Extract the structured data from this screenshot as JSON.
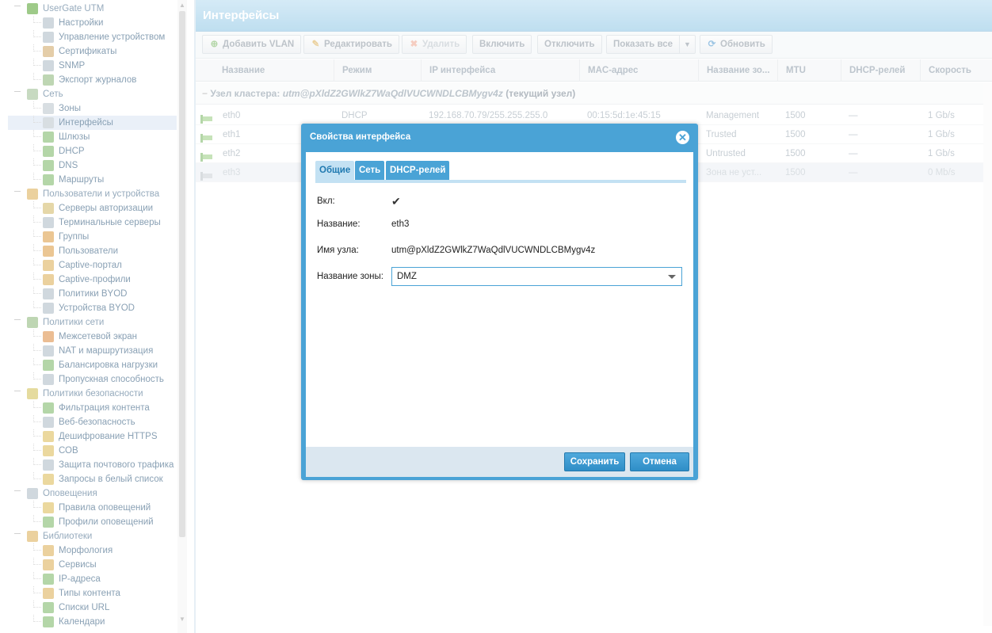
{
  "sidebar": {
    "items": [
      {
        "label": "UserGate UTM",
        "level": 0,
        "icon": "usergate-icon",
        "color": "#6aae4a"
      },
      {
        "label": "Настройки",
        "level": 1,
        "icon": "settings-icon",
        "color": "#b7c3cc"
      },
      {
        "label": "Управление устройством",
        "level": 1,
        "icon": "device-icon",
        "color": "#b7c3cc"
      },
      {
        "label": "Сертификаты",
        "level": 1,
        "icon": "certificate-icon",
        "color": "#d6b37a"
      },
      {
        "label": "SNMP",
        "level": 1,
        "icon": "snmp-icon",
        "color": "#b7c3cc"
      },
      {
        "label": "Экспорт журналов",
        "level": 1,
        "icon": "log-export-icon",
        "color": "#9bc08a"
      },
      {
        "label": "Сеть",
        "level": 0,
        "icon": "network-icon",
        "color": "#a9c7a0"
      },
      {
        "label": "Зоны",
        "level": 1,
        "icon": "zones-icon",
        "color": "#c4ccd3"
      },
      {
        "label": "Интерфейсы",
        "level": 1,
        "icon": "interfaces-icon",
        "color": "#c4ccd3",
        "selected": true
      },
      {
        "label": "Шлюзы",
        "level": 1,
        "icon": "gateways-icon",
        "color": "#8cc07a"
      },
      {
        "label": "DHCP",
        "level": 1,
        "icon": "dhcp-icon",
        "color": "#8cc07a"
      },
      {
        "label": "DNS",
        "level": 1,
        "icon": "dns-icon",
        "color": "#8cc07a"
      },
      {
        "label": "Маршруты",
        "level": 1,
        "icon": "routes-icon",
        "color": "#8cc07a"
      },
      {
        "label": "Пользователи и устройства",
        "level": 0,
        "icon": "users-devices-icon",
        "color": "#e0b86b"
      },
      {
        "label": "Серверы авторизации",
        "level": 1,
        "icon": "auth-servers-icon",
        "color": "#d8c27a"
      },
      {
        "label": "Терминальные серверы",
        "level": 1,
        "icon": "terminal-servers-icon",
        "color": "#b7c3cc"
      },
      {
        "label": "Группы",
        "level": 1,
        "icon": "groups-icon",
        "color": "#e0a85a"
      },
      {
        "label": "Пользователи",
        "level": 1,
        "icon": "users-icon",
        "color": "#e0a85a"
      },
      {
        "label": "Captive-портал",
        "level": 1,
        "icon": "captive-portal-icon",
        "color": "#e0b86b"
      },
      {
        "label": "Captive-профили",
        "level": 1,
        "icon": "captive-profiles-icon",
        "color": "#e0b86b"
      },
      {
        "label": "Политики BYOD",
        "level": 1,
        "icon": "byod-policies-icon",
        "color": "#b7c3cc"
      },
      {
        "label": "Устройства BYOD",
        "level": 1,
        "icon": "byod-devices-icon",
        "color": "#b7c3cc"
      },
      {
        "label": "Политики сети",
        "level": 0,
        "icon": "network-policies-icon",
        "color": "#9bc08a"
      },
      {
        "label": "Межсетевой экран",
        "level": 1,
        "icon": "firewall-icon",
        "color": "#e09a5a"
      },
      {
        "label": "NAT и маршрутизация",
        "level": 1,
        "icon": "nat-icon",
        "color": "#b7c3cc"
      },
      {
        "label": "Балансировка нагрузки",
        "level": 1,
        "icon": "load-balancing-icon",
        "color": "#8cc07a"
      },
      {
        "label": "Пропускная способность",
        "level": 1,
        "icon": "bandwidth-icon",
        "color": "#b7c3cc"
      },
      {
        "label": "Политики безопасности",
        "level": 0,
        "icon": "security-policies-icon",
        "color": "#d8c86a"
      },
      {
        "label": "Фильтрация контента",
        "level": 1,
        "icon": "content-filter-icon",
        "color": "#8cc07a"
      },
      {
        "label": "Веб-безопасность",
        "level": 1,
        "icon": "web-security-icon",
        "color": "#b7c3cc"
      },
      {
        "label": "Дешифрование HTTPS",
        "level": 1,
        "icon": "https-decrypt-icon",
        "color": "#e0c46a"
      },
      {
        "label": "СОВ",
        "level": 1,
        "icon": "ids-icon",
        "color": "#e0c46a"
      },
      {
        "label": "Защита почтового трафика",
        "level": 1,
        "icon": "mail-protection-icon",
        "color": "#b7c3cc"
      },
      {
        "label": "Запросы в белый список",
        "level": 1,
        "icon": "whitelist-requests-icon",
        "color": "#e0c46a"
      },
      {
        "label": "Оповещения",
        "level": 0,
        "icon": "notifications-icon",
        "color": "#b7c3cc"
      },
      {
        "label": "Правила оповещений",
        "level": 1,
        "icon": "alert-rules-icon",
        "color": "#e0c46a"
      },
      {
        "label": "Профили оповещений",
        "level": 1,
        "icon": "alert-profiles-icon",
        "color": "#8cc07a"
      },
      {
        "label": "Библиотеки",
        "level": 0,
        "icon": "libraries-icon",
        "color": "#e0b86b"
      },
      {
        "label": "Морфология",
        "level": 1,
        "icon": "morphology-icon",
        "color": "#e0b86b"
      },
      {
        "label": "Сервисы",
        "level": 1,
        "icon": "services-icon",
        "color": "#e0b86b"
      },
      {
        "label": "IP-адреса",
        "level": 1,
        "icon": "ip-addresses-icon",
        "color": "#8cc07a"
      },
      {
        "label": "Типы контента",
        "level": 1,
        "icon": "content-types-icon",
        "color": "#e0b86b"
      },
      {
        "label": "Списки URL",
        "level": 1,
        "icon": "url-lists-icon",
        "color": "#8cc07a"
      },
      {
        "label": "Календари",
        "level": 1,
        "icon": "calendars-icon",
        "color": "#8cc07a"
      }
    ]
  },
  "header": {
    "title": "Интерфейсы"
  },
  "toolbar": {
    "add_vlan": "Добавить VLAN",
    "edit": "Редактировать",
    "delete": "Удалить",
    "enable": "Включить",
    "disable": "Отключить",
    "show_all": "Показать все",
    "refresh": "Обновить"
  },
  "grid": {
    "columns": [
      "Название",
      "Режим",
      "IP интерфейса",
      "MAC-адрес",
      "Название зо...",
      "MTU",
      "DHCP-релей",
      "Скорость"
    ],
    "group_prefix": "Узел кластера:",
    "group_node": "utm@pXldZ2GWlkZ7WaQdlVUCWNDLCBMygv4z",
    "group_suffix": "(текущий узел)",
    "rows": [
      {
        "name": "eth0",
        "mode": "DHCP",
        "ip": "192.168.70.79/255.255.255.0",
        "mac": "00:15:5d:1e:45:15",
        "zone": "Management",
        "mtu": "1500",
        "relay": "—",
        "speed": "1 Gb/s"
      },
      {
        "name": "eth1",
        "mode": "",
        "ip": "",
        "mac": "",
        "zone": "Trusted",
        "mtu": "1500",
        "relay": "—",
        "speed": "1 Gb/s"
      },
      {
        "name": "eth2",
        "mode": "",
        "ip": "",
        "mac": "",
        "zone": "Untrusted",
        "mtu": "1500",
        "relay": "—",
        "speed": "1 Gb/s"
      },
      {
        "name": "eth3",
        "mode": "",
        "ip": "",
        "mac": "",
        "zone": "Зона не уст...",
        "mtu": "1500",
        "relay": "—",
        "speed": "0 Mb/s"
      }
    ]
  },
  "dialog": {
    "title": "Свойства интерфейса",
    "tabs": [
      "Общие",
      "Сеть",
      "DHCP-релей"
    ],
    "active_tab": "Общие",
    "enabled_label": "Вкл:",
    "enabled_checked": true,
    "name_label": "Название:",
    "name_value": "eth3",
    "node_label": "Имя узла:",
    "node_value": "utm@pXldZ2GWlkZ7WaQdlVUCWNDLCBMygv4z",
    "zone_label": "Название зоны:",
    "zone_value": "DMZ",
    "save": "Сохранить",
    "cancel": "Отмена"
  },
  "colors": {
    "accent": "#4aa3d6",
    "header_bg": "#a8d4ec",
    "selected_row": "#dfe9f5"
  }
}
